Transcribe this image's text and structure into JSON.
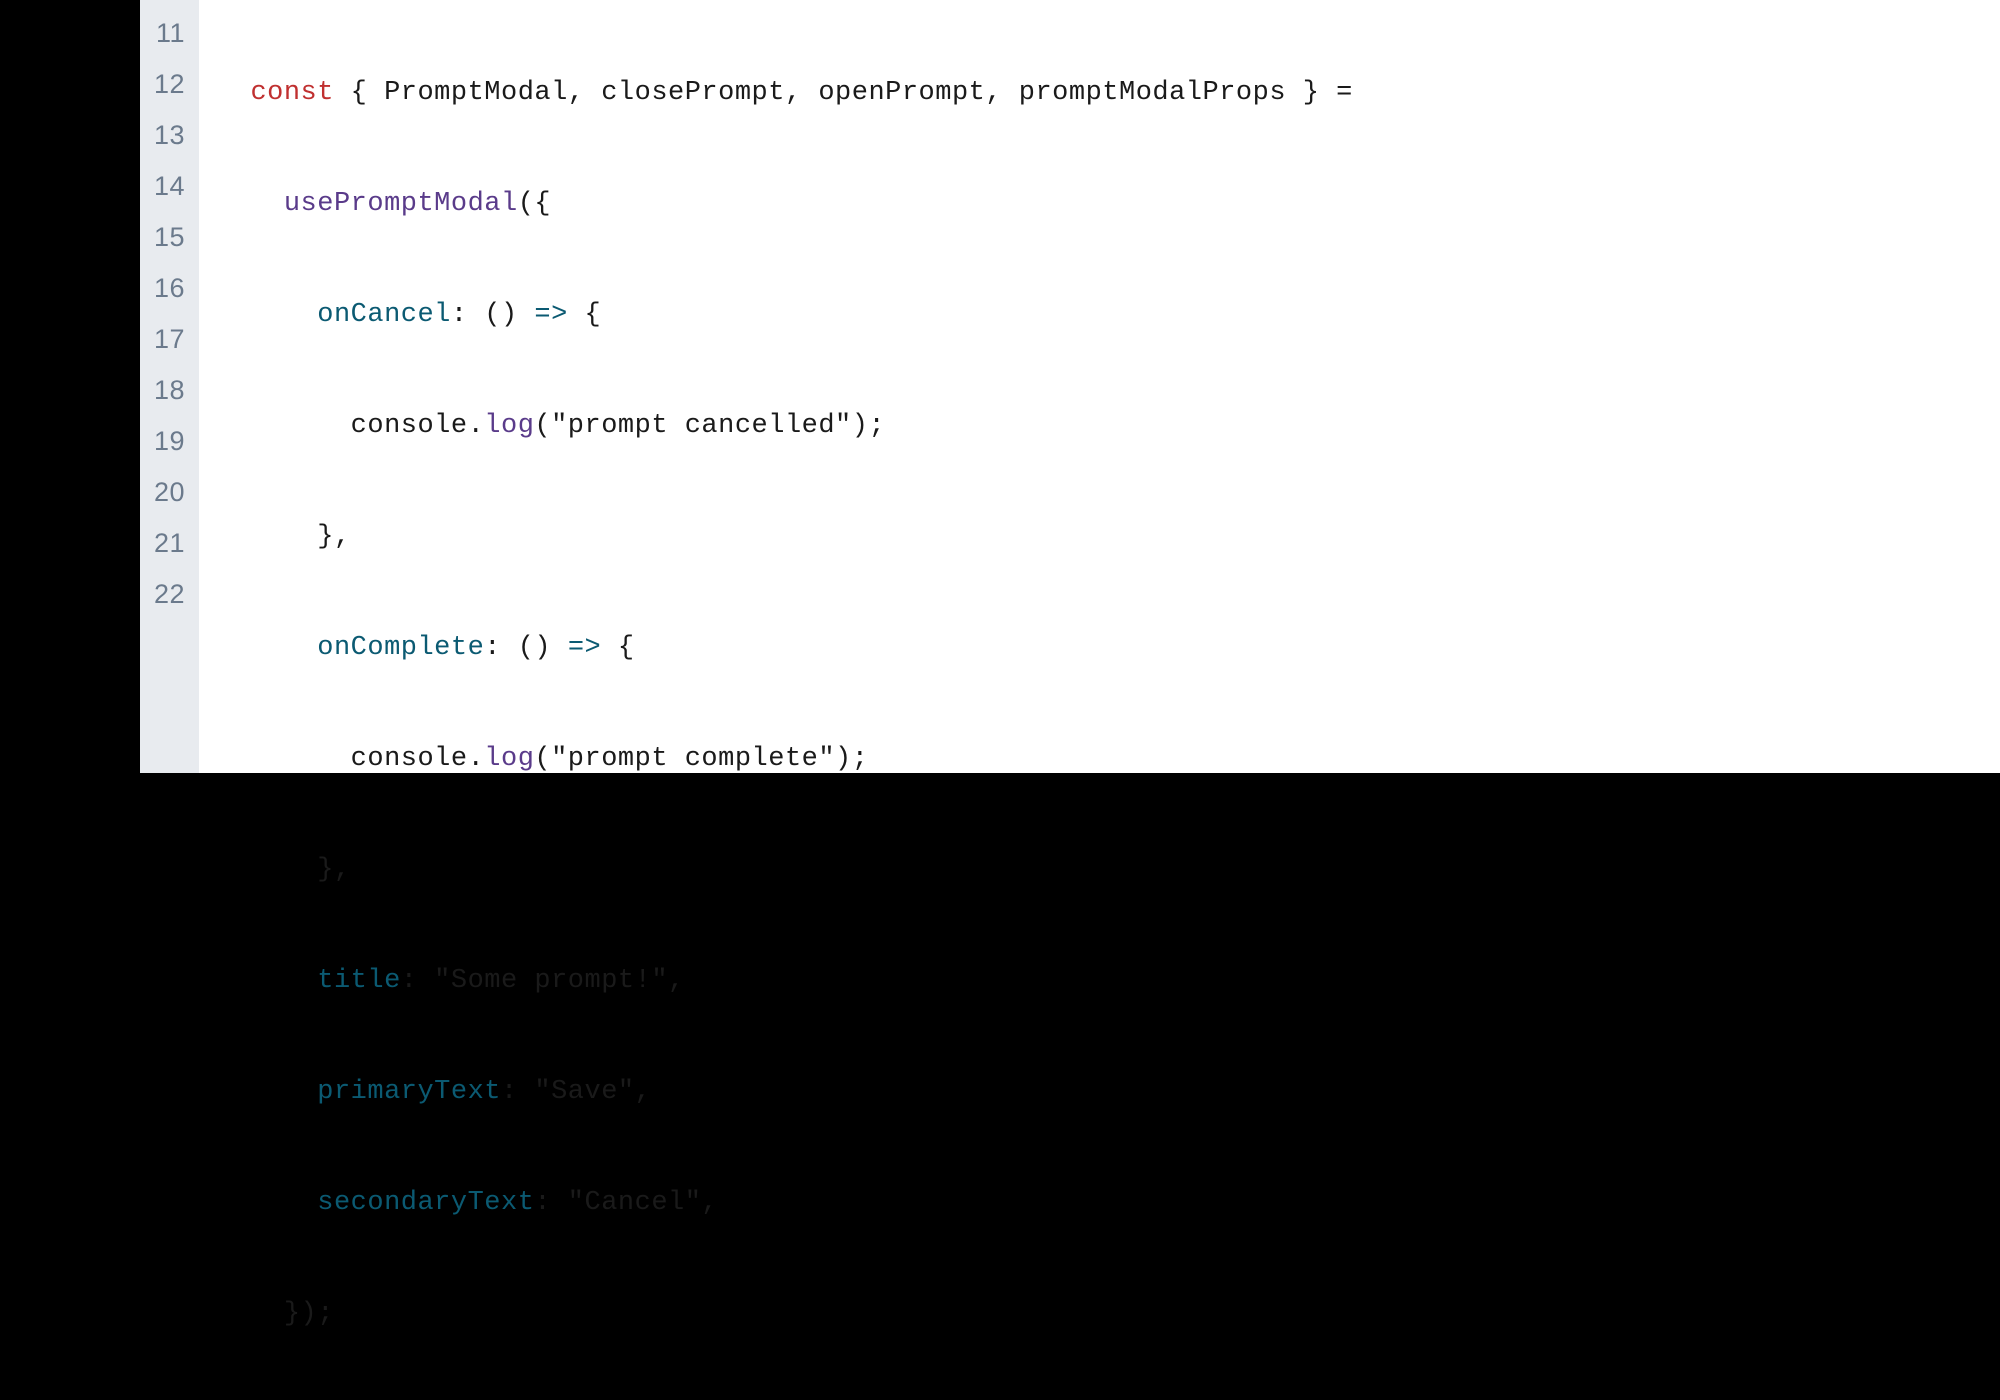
{
  "gutter": {
    "lines": [
      "11",
      "12",
      "13",
      "14",
      "15",
      "16",
      "17",
      "18",
      "19",
      "20",
      "21",
      "22"
    ]
  },
  "code": {
    "line11": {
      "kw": "const",
      "destruct": " { PromptModal, closePrompt, openPrompt, promptModalProps } ",
      "eq": "="
    },
    "line12": {
      "indent": "    ",
      "fn": "usePromptModal",
      "rest": "({"
    },
    "line13": {
      "indent": "      ",
      "prop": "onCancel",
      "colon": ": () ",
      "arrow": "=>",
      "rest": " {"
    },
    "line14": {
      "indent": "        console.",
      "fn": "log",
      "args": "(\"prompt cancelled\");"
    },
    "line15": {
      "indent": "      },",
      "rest": ""
    },
    "line16": {
      "indent": "      ",
      "prop": "onComplete",
      "colon": ": () ",
      "arrow": "=>",
      "rest": " {"
    },
    "line17": {
      "indent": "        console.",
      "fn": "log",
      "args": "(\"prompt complete\");"
    },
    "line18": {
      "indent": "      },",
      "rest": ""
    },
    "line19": {
      "indent": "      ",
      "prop": "title",
      "rest": ": \"Some prompt!\","
    },
    "line20": {
      "indent": "      ",
      "prop": "primaryText",
      "rest": ": \"Save\","
    },
    "line21": {
      "indent": "      ",
      "prop": "secondaryText",
      "rest": ": \"Cancel\","
    },
    "line22": {
      "indent": "    });",
      "rest": ""
    }
  }
}
